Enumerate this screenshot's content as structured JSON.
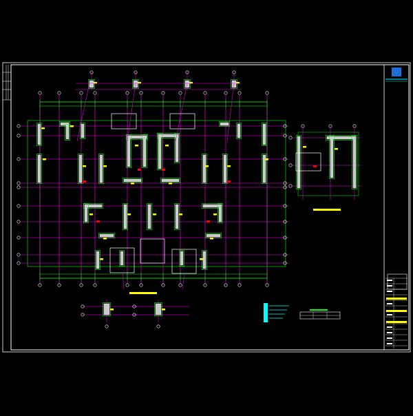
{
  "drawing": {
    "background": "#000000",
    "colors": {
      "frame": "#ffffff",
      "grid": "#ff00ff",
      "dimension": "#00ff00",
      "wall": "#ffffff",
      "wall_fill": "#c8c8c8",
      "rebar": "#00ff00",
      "tag": "#ffff00",
      "cyan": "#00ffff",
      "red": "#ff0000",
      "logo_blue": "#1e6fd9"
    },
    "title_block": {
      "logo_icon": "company-logo-icon"
    },
    "legend_title": "",
    "table_header": "",
    "icons": [
      "company-logo-icon",
      "grid-bubble-icon",
      "section-marker-icon"
    ]
  }
}
